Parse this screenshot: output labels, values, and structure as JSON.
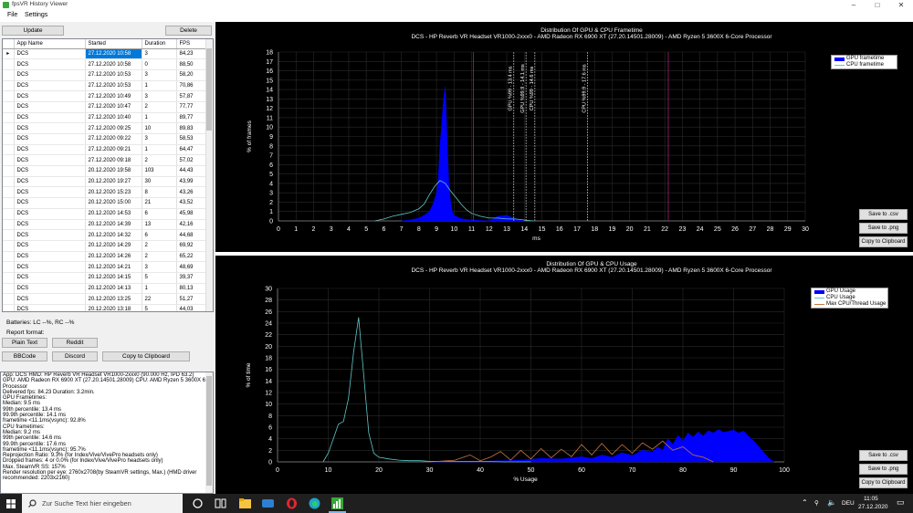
{
  "window": {
    "title": "fpsVR History Viewer",
    "controls": [
      "–",
      "□",
      "✕"
    ]
  },
  "menu": [
    "File",
    "Settings"
  ],
  "toolbar": {
    "update_label": "Update",
    "delete_label": "Delete"
  },
  "table": {
    "columns": [
      "App Name",
      "Started",
      "Duration",
      "FPS"
    ],
    "rows": [
      [
        "DCS",
        "27.12.2020 10:58",
        "3",
        "84,23"
      ],
      [
        "DCS",
        "27.12.2020 10:58",
        "0",
        "88,50"
      ],
      [
        "DCS",
        "27.12.2020 10:53",
        "3",
        "58,20"
      ],
      [
        "DCS",
        "27.12.2020 10:53",
        "1",
        "70,86"
      ],
      [
        "DCS",
        "27.12.2020 10:49",
        "3",
        "57,87"
      ],
      [
        "DCS",
        "27.12.2020 10:47",
        "2",
        "77,77"
      ],
      [
        "DCS",
        "27.12.2020 10:40",
        "1",
        "89,77"
      ],
      [
        "DCS",
        "27.12.2020 09:25",
        "10",
        "89,83"
      ],
      [
        "DCS",
        "27.12.2020 09:22",
        "3",
        "58,53"
      ],
      [
        "DCS",
        "27.12.2020 09:21",
        "1",
        "64,47"
      ],
      [
        "DCS",
        "27.12.2020 09:18",
        "2",
        "57,02"
      ],
      [
        "DCS",
        "20.12.2020 19:58",
        "103",
        "44,43"
      ],
      [
        "DCS",
        "20.12.2020 19:27",
        "30",
        "43,99"
      ],
      [
        "DCS",
        "20.12.2020 15:23",
        "8",
        "43,26"
      ],
      [
        "DCS",
        "20.12.2020 15:00",
        "21",
        "43,52"
      ],
      [
        "DCS",
        "20.12.2020 14:53",
        "6",
        "45,98"
      ],
      [
        "DCS",
        "20.12.2020 14:39",
        "13",
        "42,16"
      ],
      [
        "DCS",
        "20.12.2020 14:32",
        "6",
        "44,68"
      ],
      [
        "DCS",
        "20.12.2020 14:29",
        "2",
        "69,92"
      ],
      [
        "DCS",
        "20.12.2020 14:26",
        "2",
        "65,22"
      ],
      [
        "DCS",
        "20.12.2020 14:21",
        "3",
        "48,69"
      ],
      [
        "DCS",
        "20.12.2020 14:15",
        "5",
        "39,37"
      ],
      [
        "DCS",
        "20.12.2020 14:13",
        "1",
        "80,13"
      ],
      [
        "DCS",
        "20.12.2020 13:25",
        "22",
        "51,27"
      ],
      [
        "DCS",
        "20.12.2020 13:18",
        "5",
        "44,03"
      ]
    ],
    "selected_row": 0
  },
  "batteries": "Batteries: LC --%, RC --%",
  "report_format_label": "Report format:",
  "report_buttons": {
    "plain": "Plain Text",
    "reddit": "Reddit",
    "bbcode": "BBCode",
    "discord": "Discord",
    "clipboard": "Copy to Clipboard"
  },
  "report_lines": [
    "App: DCS HMD: HP Reverb VR Headset VR1000-2xxx0 (90.000 Hz, IPD 63.2)",
    "GPU: AMD Radeon RX 6900 XT (27.20.14501.28009) CPU: AMD Ryzen 5 3600X 6-Core",
    "Processor",
    "Delivered fps: 84.23  Duration: 3.2min.",
    "GPU Frametimes:",
    "Median: 9.5 ms",
    "99th percentile: 13.4 ms",
    "99.9th percentile: 14.1 ms",
    "frametime <11.1ms(vsync): 92.8%",
    "CPU frametimes:",
    "Median: 9.2 ms",
    "99th percentile: 14.6 ms",
    "99.9th percentile: 17.6 ms",
    "frametime <11.1ms(vsync): 95.7%",
    "Reprojection Ratio: 9.3% (for Index/Vive/VivePro headsets only)",
    "Dropped frames: 4 or 0.0% (for Index/Vive/VivePro headsets only)",
    "Max. SteamVR SS: 157%",
    "Render resolution per eye: 2760x2708(by SteamVR settings, Max.) (HMD driver",
    "recommended: 2203x2160)"
  ],
  "chart_buttons": {
    "csv": "Save to .csv",
    "png": "Save to .png",
    "clip": "Copy to Clipboard"
  },
  "colors": {
    "gpu": "#0000ff",
    "cpu": "#5fc7c7",
    "thread": "#c8763c",
    "marker": "#a0207a"
  },
  "chart_data": [
    {
      "type": "area",
      "title": "Distribution Of GPU & CPU Frametime",
      "subtitle": "DCS - HP Reverb VR Headset VR1000-2xxx0 - AMD Radeon RX 6900 XT (27.20.14501.28009) - AMD Ryzen 5 3600X 6-Core Processor",
      "xlabel": "ms",
      "ylabel": "% of frames",
      "xlim": [
        0,
        30
      ],
      "ylim": [
        0,
        18
      ],
      "xticks": [
        0,
        1,
        2,
        3,
        4,
        5,
        6,
        7,
        8,
        9,
        10,
        11,
        12,
        13,
        14,
        15,
        16,
        17,
        18,
        19,
        20,
        21,
        22,
        23,
        24,
        25,
        26,
        27,
        28,
        29,
        30
      ],
      "yticks": [
        0,
        1,
        2,
        3,
        4,
        5,
        6,
        7,
        8,
        9,
        10,
        11,
        12,
        13,
        14,
        15,
        16,
        17,
        18
      ],
      "legend": "top-right",
      "series": [
        {
          "name": "GPU frametime",
          "x": [
            7.0,
            7.5,
            8.0,
            8.3,
            8.6,
            8.8,
            9.0,
            9.1,
            9.2,
            9.3,
            9.4,
            9.5,
            9.6,
            9.7,
            9.8,
            9.9,
            10.0,
            10.2,
            10.5,
            11.0,
            12.0,
            12.5,
            13.0,
            13.5,
            14.0
          ],
          "y": [
            0,
            0.1,
            0.3,
            0.6,
            1.0,
            1.8,
            3.0,
            4.5,
            8.0,
            10.5,
            13.0,
            14.3,
            9.0,
            4.0,
            2.0,
            1.0,
            0.6,
            0.4,
            0.2,
            0.1,
            0,
            0.5,
            0.6,
            0.2,
            0
          ]
        },
        {
          "name": "CPU frametime",
          "x": [
            5.5,
            6.0,
            6.5,
            7.0,
            7.5,
            8.0,
            8.3,
            8.6,
            8.9,
            9.2,
            9.5,
            9.8,
            10.1,
            10.4,
            10.7,
            11.0,
            11.5,
            12.0,
            12.5,
            13.0,
            13.5,
            14.0,
            14.5
          ],
          "y": [
            0,
            0.2,
            0.5,
            0.7,
            0.9,
            1.3,
            1.8,
            2.8,
            3.7,
            4.3,
            4.0,
            3.2,
            2.5,
            1.8,
            1.2,
            0.8,
            0.5,
            0.3,
            0.3,
            0.2,
            0.2,
            0.1,
            0
          ]
        }
      ],
      "markers": [
        {
          "x": 11.1,
          "label": ""
        },
        {
          "x": 22.2,
          "label": ""
        },
        {
          "x": 13.4,
          "label": "GPU %99 - 13.4 ms"
        },
        {
          "x": 14.1,
          "label": "GPU %99.9 - 14.1 ms"
        },
        {
          "x": 14.6,
          "label": "CPU %99 - 14.6 ms"
        },
        {
          "x": 17.6,
          "label": "CPU %99.9 - 17.6 ms"
        }
      ]
    },
    {
      "type": "area",
      "title": "Distribution Of GPU & CPU Usage",
      "subtitle": "DCS - HP Reverb VR Headset VR1000-2xxx0 - AMD Radeon RX 6900 XT (27.20.14501.28009) - AMD Ryzen 5 3600X 6-Core Processor",
      "xlabel": "% Usage",
      "ylabel": "% of time",
      "xlim": [
        0,
        100
      ],
      "ylim": [
        0,
        30
      ],
      "xticks": [
        0,
        10,
        20,
        30,
        40,
        50,
        60,
        70,
        80,
        90,
        100
      ],
      "yticks": [
        0,
        2,
        4,
        6,
        8,
        10,
        12,
        14,
        16,
        18,
        20,
        22,
        24,
        26,
        28,
        30
      ],
      "legend": "top-right",
      "series": [
        {
          "name": "GPU Usage",
          "x": [
            30,
            40,
            48,
            52,
            56,
            60,
            62,
            64,
            66,
            68,
            70,
            72,
            74,
            75,
            76,
            77,
            78,
            79,
            80,
            81,
            82,
            83,
            84,
            85,
            86,
            87,
            88,
            89,
            90,
            91,
            92,
            93,
            94,
            95,
            96,
            97,
            98
          ],
          "y": [
            0,
            0.1,
            0.3,
            0.6,
            0.5,
            0.9,
            0.6,
            1.2,
            0.8,
            1.6,
            1.1,
            2.0,
            1.7,
            2.6,
            2.0,
            4.0,
            3.0,
            4.6,
            3.6,
            5.0,
            4.3,
            5.2,
            4.5,
            5.4,
            5.0,
            5.6,
            5.1,
            5.3,
            5.5,
            5.0,
            5.3,
            4.4,
            3.6,
            2.6,
            1.6,
            0.6,
            0
          ]
        },
        {
          "name": "CPU Usage",
          "x": [
            9,
            10,
            11,
            12,
            13,
            14,
            15,
            16,
            17,
            18,
            19,
            20,
            22,
            24,
            26,
            28,
            30,
            35,
            40,
            45,
            50
          ],
          "y": [
            0,
            1.5,
            4.0,
            6.5,
            7.0,
            11.0,
            19.0,
            25.0,
            15.0,
            5.0,
            1.5,
            0.8,
            0.5,
            0.3,
            0.2,
            0.2,
            0.1,
            0.1,
            0.1,
            0,
            0
          ]
        },
        {
          "name": "Max CPU/Thread Usage",
          "x": [
            30,
            35,
            38,
            40,
            42,
            44,
            46,
            48,
            50,
            52,
            54,
            56,
            58,
            60,
            62,
            64,
            66,
            68,
            70,
            72,
            74,
            76,
            78,
            80,
            82,
            84,
            86
          ],
          "y": [
            0,
            0.3,
            1.2,
            0.2,
            0.8,
            1.8,
            0.3,
            2.0,
            0.5,
            2.3,
            0.7,
            2.2,
            0.9,
            3.0,
            1.2,
            3.2,
            1.3,
            3.0,
            1.5,
            3.3,
            2.2,
            3.6,
            2.0,
            2.6,
            1.2,
            0.8,
            0
          ]
        }
      ]
    }
  ],
  "taskbar": {
    "search_placeholder": "Zur Suche Text hier eingeben",
    "lang": "DEU",
    "time": "11:05",
    "date": "27.12.2020"
  }
}
